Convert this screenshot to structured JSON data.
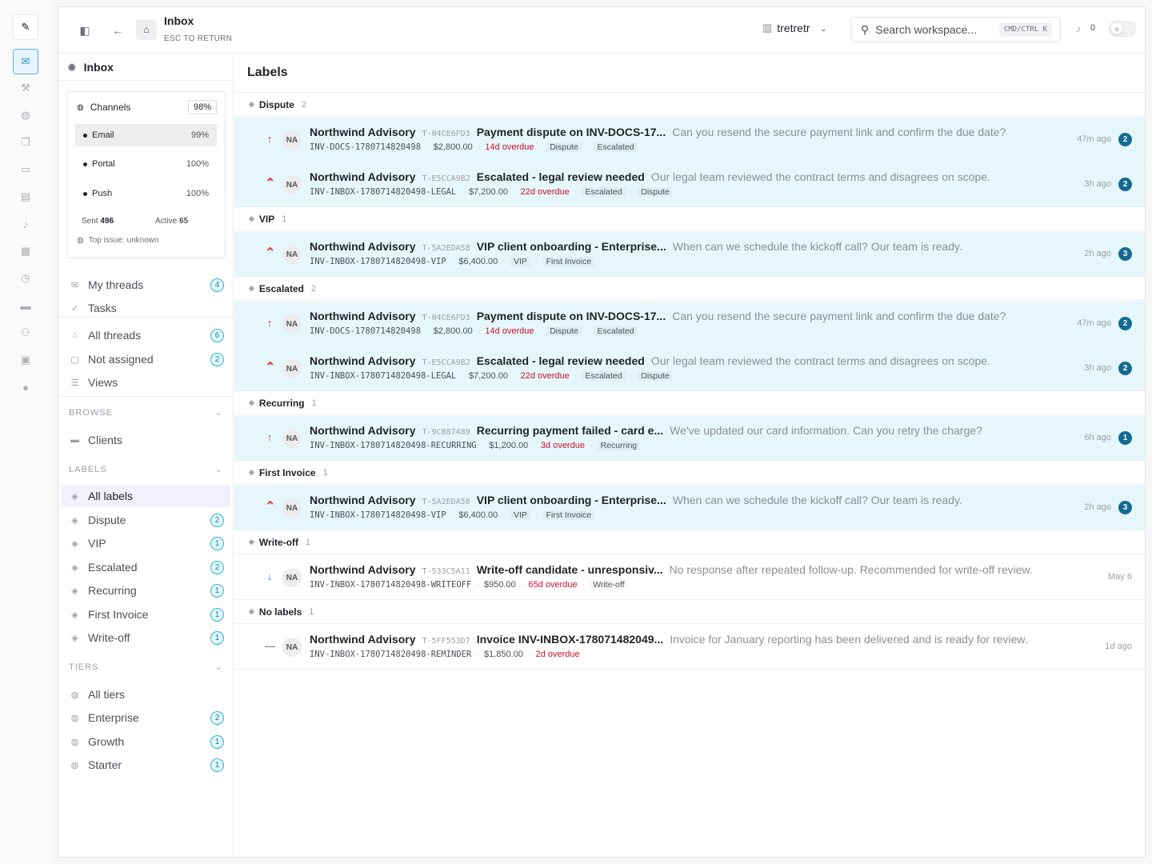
{
  "rail": {
    "icons": [
      "pen-icon",
      "inbox-icon",
      "tools-icon",
      "globe-icon",
      "copy-icon",
      "card-icon",
      "doc-check-icon",
      "bell-icon",
      "doc-settings-icon",
      "clock-icon",
      "folder-icon",
      "users-icon",
      "archive-icon",
      "notification-icon"
    ]
  },
  "topbar": {
    "title": "Inbox",
    "subtitle": "ESC TO RETURN",
    "workspace": "tretretr",
    "search_placeholder": "Search workspace...",
    "shortcut": "CMD/CTRL K",
    "notifications": "0"
  },
  "sidebar": {
    "header": "Inbox",
    "channels": {
      "title": "Channels",
      "pct": "98%",
      "rows": [
        {
          "name": "Email",
          "value": "99%"
        },
        {
          "name": "Portal",
          "value": "100%"
        },
        {
          "name": "Push",
          "value": "100%"
        }
      ],
      "sent_label": "Sent",
      "sent": "496",
      "active_label": "Active",
      "active": "65",
      "top_issue": "Top issue: unknown"
    },
    "nav": [
      {
        "label": "My threads",
        "count": "4"
      },
      {
        "label": "Tasks",
        "count": ""
      },
      {
        "label": "All threads",
        "count": "6"
      },
      {
        "label": "Not assigned",
        "count": "2"
      },
      {
        "label": "Views",
        "count": ""
      }
    ],
    "browse_label": "BROWSE",
    "browse": [
      {
        "label": "Clients"
      }
    ],
    "labels_label": "LABELS",
    "labels": [
      {
        "label": "All labels",
        "count": ""
      },
      {
        "label": "Dispute",
        "count": "2"
      },
      {
        "label": "VIP",
        "count": "1"
      },
      {
        "label": "Escalated",
        "count": "2"
      },
      {
        "label": "Recurring",
        "count": "1"
      },
      {
        "label": "First Invoice",
        "count": "1"
      },
      {
        "label": "Write-off",
        "count": "1"
      }
    ],
    "tiers_label": "TIERS",
    "tiers": [
      {
        "label": "All tiers",
        "count": ""
      },
      {
        "label": "Enterprise",
        "count": "2"
      },
      {
        "label": "Growth",
        "count": "1"
      },
      {
        "label": "Starter",
        "count": "1"
      }
    ]
  },
  "main": {
    "title": "Labels",
    "groups": [
      {
        "name": "Dispute",
        "count": "2"
      },
      {
        "name": "VIP",
        "count": "1"
      },
      {
        "name": "Escalated",
        "count": "2"
      },
      {
        "name": "Recurring",
        "count": "1"
      },
      {
        "name": "First Invoice",
        "count": "1"
      },
      {
        "name": "Write-off",
        "count": "1"
      },
      {
        "name": "No labels",
        "count": "1"
      }
    ],
    "rows": [
      {
        "avatar": "NA",
        "company": "Northwind Advisory",
        "tid": "T-04CE6FD3",
        "subject": "Payment dispute on INV-DOCS-17...",
        "preview": "Can you resend the secure payment link and confirm the due date?",
        "invoice": "INV-DOCS-1780714820498",
        "amount": "$2,800.00",
        "overdue": "14d overdue",
        "tag1": "Dispute",
        "tag2": "Escalated",
        "time": "47m ago",
        "badge": "2"
      },
      {
        "avatar": "NA",
        "company": "Northwind Advisory",
        "tid": "T-E5CCA9B2",
        "subject": "Escalated - legal review needed",
        "preview": "Our legal team reviewed the contract terms and disagrees on scope.",
        "invoice": "INV-INBOX-1780714820498-LEGAL",
        "amount": "$7,200.00",
        "overdue": "22d overdue",
        "tag1": "Escalated",
        "tag2": "Dispute",
        "time": "3h ago",
        "badge": "2"
      },
      {
        "avatar": "NA",
        "company": "Northwind Advisory",
        "tid": "T-5A2EDA58",
        "subject": "VIP client onboarding - Enterprise...",
        "preview": "When can we schedule the kickoff call? Our team is ready.",
        "invoice": "INV-INBOX-1780714820498-VIP",
        "amount": "$6,400.00",
        "overdue": "",
        "tag1": "VIP",
        "tag2": "First Invoice",
        "time": "2h ago",
        "badge": "3"
      },
      {
        "avatar": "NA",
        "company": "Northwind Advisory",
        "tid": "T-04CE6FD3",
        "subject": "Payment dispute on INV-DOCS-17...",
        "preview": "Can you resend the secure payment link and confirm the due date?",
        "invoice": "INV-DOCS-1780714820498",
        "amount": "$2,800.00",
        "overdue": "14d overdue",
        "tag1": "Dispute",
        "tag2": "Escalated",
        "time": "47m ago",
        "badge": "2"
      },
      {
        "avatar": "NA",
        "company": "Northwind Advisory",
        "tid": "T-E5CCA9B2",
        "subject": "Escalated - legal review needed",
        "preview": "Our legal team reviewed the contract terms and disagrees on scope.",
        "invoice": "INV-INBOX-1780714820498-LEGAL",
        "amount": "$7,200.00",
        "overdue": "22d overdue",
        "tag1": "Escalated",
        "tag2": "Dispute",
        "time": "3h ago",
        "badge": "2"
      },
      {
        "avatar": "NA",
        "company": "Northwind Advisory",
        "tid": "T-9CB87489",
        "subject": "Recurring payment failed - card e...",
        "preview": "We've updated our card information. Can you retry the charge?",
        "invoice": "INV-INBOX-1780714820498-RECURRING",
        "amount": "$1,200.00",
        "overdue": "3d overdue",
        "tag1": "Recurring",
        "tag2": "",
        "time": "6h ago",
        "badge": "1"
      },
      {
        "avatar": "NA",
        "company": "Northwind Advisory",
        "tid": "T-5A2EDA58",
        "subject": "VIP client onboarding - Enterprise...",
        "preview": "When can we schedule the kickoff call? Our team is ready.",
        "invoice": "INV-INBOX-1780714820498-VIP",
        "amount": "$6,400.00",
        "overdue": "",
        "tag1": "VIP",
        "tag2": "First Invoice",
        "time": "2h ago",
        "badge": "3"
      },
      {
        "avatar": "NA",
        "company": "Northwind Advisory",
        "tid": "T-533C5A11",
        "subject": "Write-off candidate - unresponsiv...",
        "preview": "No response after repeated follow-up. Recommended for write-off review.",
        "invoice": "INV-INBOX-1780714820498-WRITEOFF",
        "amount": "$950.00",
        "overdue": "65d overdue",
        "tag1": "Write-off",
        "tag2": "",
        "time": "May 6",
        "badge": ""
      },
      {
        "avatar": "NA",
        "company": "Northwind Advisory",
        "tid": "T-5FF553D7",
        "subject": "Invoice INV-INBOX-178071482049...",
        "preview": "Invoice for January reporting has been delivered and is ready for review.",
        "invoice": "INV-INBOX-1780714820498-REMINDER",
        "amount": "$1,850.00",
        "overdue": "2d overdue",
        "tag1": "",
        "tag2": "",
        "time": "1d ago",
        "badge": ""
      }
    ]
  }
}
